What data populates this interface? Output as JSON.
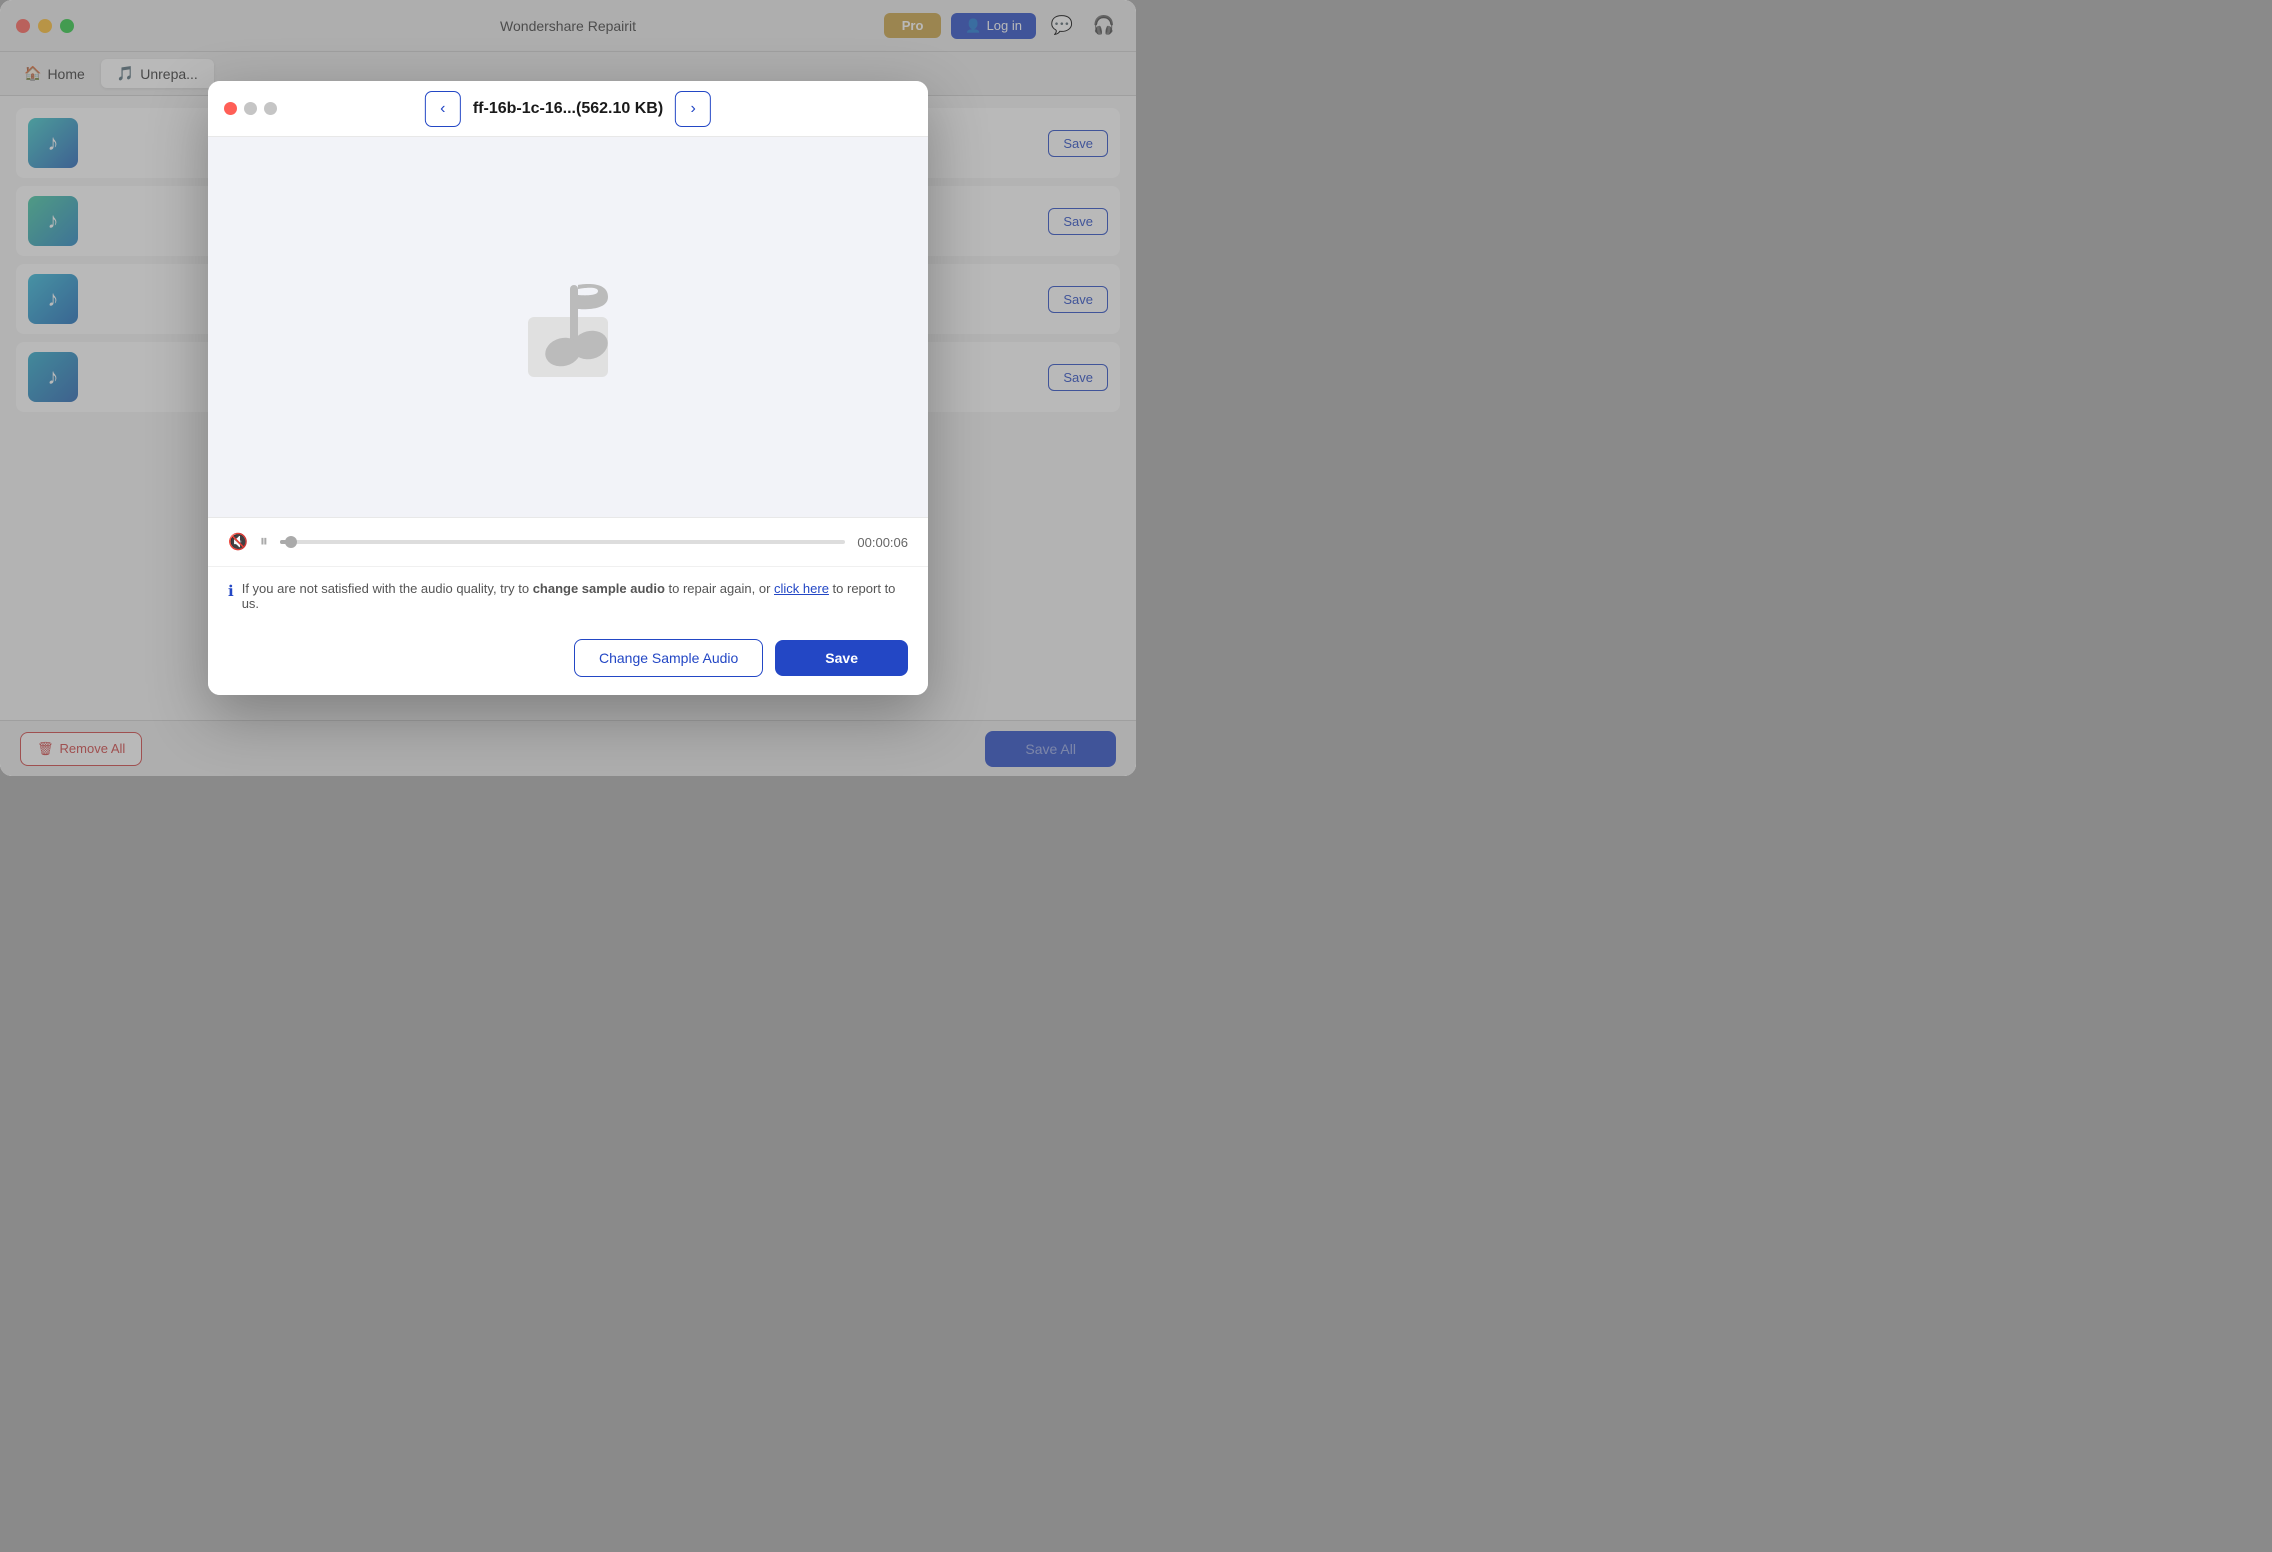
{
  "app": {
    "title": "Wondershare Repairit",
    "pro_label": "Pro",
    "login_label": "Log in"
  },
  "nav": {
    "home_label": "Home",
    "unrepairable_label": "Unrepa..."
  },
  "audio_items": [
    {
      "id": 1,
      "save_label": "Save"
    },
    {
      "id": 2,
      "save_label": "Save"
    },
    {
      "id": 3,
      "save_label": "Save"
    },
    {
      "id": 4,
      "save_label": "Save"
    }
  ],
  "bottom_bar": {
    "remove_all_label": "Remove All",
    "save_all_label": "Save All"
  },
  "modal": {
    "filename": "ff-16b-1c-16...(562.10 KB)",
    "prev_label": "‹",
    "next_label": "›",
    "player_time": "00:00:06",
    "info_text_before": "If you are not satisfied with the audio quality, try to ",
    "info_bold": "change sample audio",
    "info_text_middle": " to repair again, or ",
    "info_link": "click here",
    "info_text_after": " to report to us.",
    "change_sample_label": "Change Sample Audio",
    "save_label": "Save",
    "traffic": {
      "close": "●",
      "minimize": "●",
      "maximize": "●"
    }
  }
}
